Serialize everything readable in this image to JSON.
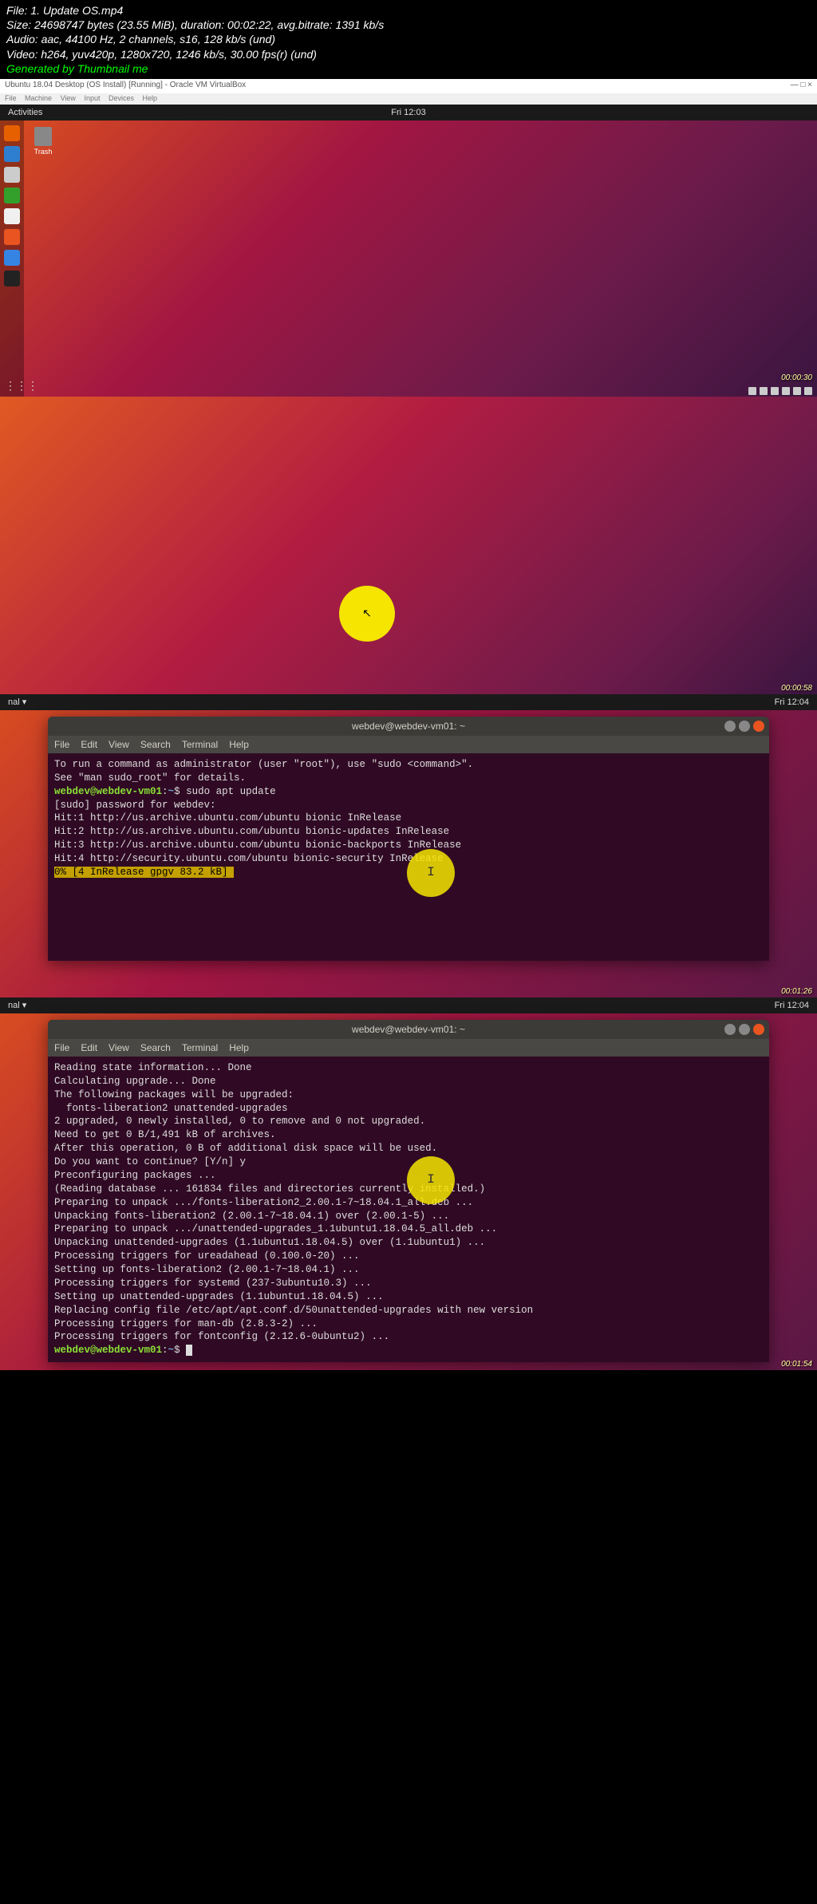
{
  "header": {
    "file_line": "File: 1. Update OS.mp4",
    "size_line": "Size: 24698747 bytes (23.55 MiB), duration: 00:02:22, avg.bitrate: 1391 kb/s",
    "audio_line": "Audio: aac, 44100 Hz, 2 channels, s16, 128 kb/s (und)",
    "video_line": "Video: h264, yuv420p, 1280x720, 1246 kb/s, 30.00 fps(r) (und)",
    "generated_by": "Generated by Thumbnail me"
  },
  "vm": {
    "title": "Ubuntu 18.04 Desktop (OS Install) [Running] - Oracle VM VirtualBox",
    "menu": [
      "File",
      "Machine",
      "View",
      "Input",
      "Devices",
      "Help"
    ]
  },
  "topbar": {
    "activities": "Activities",
    "clock1": "Fri 12:03",
    "clock2": "Fri 12:04"
  },
  "trash_label": "Trash",
  "terminal": {
    "title": "webdev@webdev-vm01: ~",
    "menu": [
      "File",
      "Edit",
      "View",
      "Search",
      "Terminal",
      "Help"
    ],
    "prompt_user": "webdev@webdev-vm01",
    "prompt_path": "~",
    "prompt_suffix": "$ ",
    "f3_lines": [
      "To run a command as administrator (user \"root\"), use \"sudo <command>\".",
      "See \"man sudo_root\" for details.",
      "",
      "",
      "[sudo] password for webdev:",
      "Hit:1 http://us.archive.ubuntu.com/ubuntu bionic InRelease",
      "Hit:2 http://us.archive.ubuntu.com/ubuntu bionic-updates InRelease",
      "Hit:3 http://us.archive.ubuntu.com/ubuntu bionic-backports InRelease",
      "Hit:4 http://security.ubuntu.com/ubuntu bionic-security InRelease"
    ],
    "f3_cmd": "sudo apt update",
    "f3_progress": "0% [4 InRelease gpgv 83.2 kB]",
    "f4_lines": [
      "Reading state information... Done",
      "Calculating upgrade... Done",
      "The following packages will be upgraded:",
      "  fonts-liberation2 unattended-upgrades",
      "2 upgraded, 0 newly installed, 0 to remove and 0 not upgraded.",
      "Need to get 0 B/1,491 kB of archives.",
      "After this operation, 0 B of additional disk space will be used.",
      "Do you want to continue? [Y/n] y",
      "Preconfiguring packages ...",
      "(Reading database ... 161834 files and directories currently installed.)",
      "Preparing to unpack .../fonts-liberation2_2.00.1-7~18.04.1_all.deb ...",
      "Unpacking fonts-liberation2 (2.00.1-7~18.04.1) over (2.00.1-5) ...",
      "Preparing to unpack .../unattended-upgrades_1.1ubuntu1.18.04.5_all.deb ...",
      "Unpacking unattended-upgrades (1.1ubuntu1.18.04.5) over (1.1ubuntu1) ...",
      "Processing triggers for ureadahead (0.100.0-20) ...",
      "Setting up fonts-liberation2 (2.00.1-7~18.04.1) ...",
      "Processing triggers for systemd (237-3ubuntu10.3) ...",
      "Setting up unattended-upgrades (1.1ubuntu1.18.04.5) ...",
      "Replacing config file /etc/apt/apt.conf.d/50unattended-upgrades with new version",
      "Processing triggers for man-db (2.8.3-2) ...",
      "Processing triggers for fontconfig (2.12.6-0ubuntu2) ..."
    ]
  },
  "timestamps": {
    "f1": "00:00:30",
    "f2": "00:00:58",
    "f3": "00:01:26",
    "f4": "00:01:54"
  },
  "nal": "nal ▾",
  "dock_colors": [
    "#e66000",
    "#2e7fd0",
    "#33a02c",
    "#d0d0d0",
    "#f0f0f0",
    "#e95420",
    "#3584e4",
    "#333333"
  ]
}
